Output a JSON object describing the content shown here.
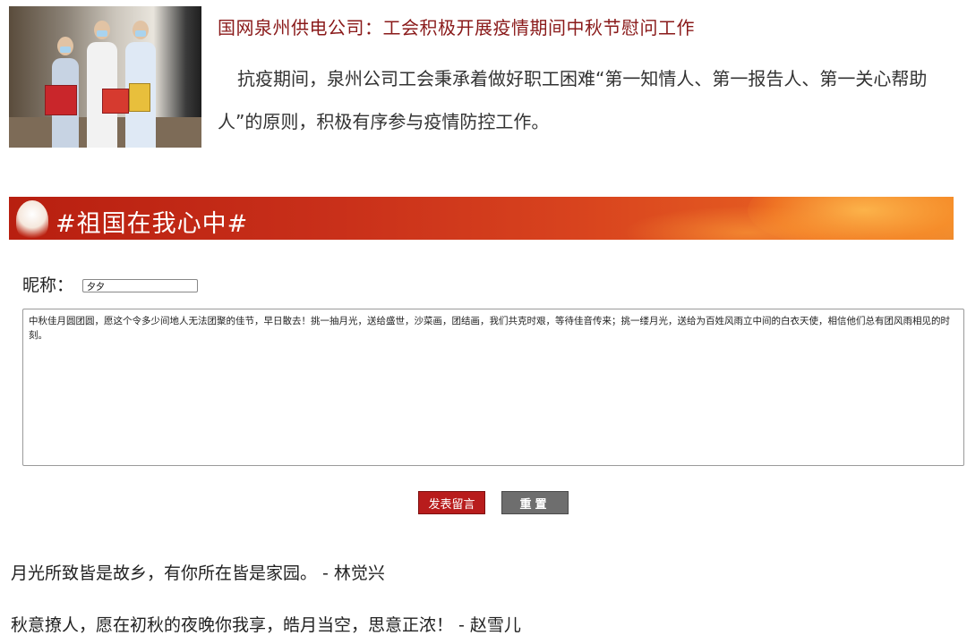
{
  "article": {
    "title": "国网泉州供电公司：工会积极开展疫情期间中秋节慰问工作",
    "body": "抗疫期间，泉州公司工会秉承着做好职工困难“第一知情人、第一报告人、第一关心帮助人”的原则，积极有序参与疫情防控工作。"
  },
  "banner": {
    "title": "#祖国在我心中#"
  },
  "form": {
    "nickname_label": "昵称：",
    "nickname_value": "夕夕",
    "message_value": "中秋佳月圆团圆，愿这个令多少间地人无法团聚的佳节，早日散去！挑一抽月光，送给盛世，沙菜画，团结画，我们共克时艰，等待佳音传来；挑一缕月光，送给为百姓风雨立中间的白衣天使，相信他们总有团风雨相见的时刻。",
    "submit_label": "发表留言",
    "reset_label": "重置"
  },
  "comments": [
    {
      "text": "月光所致皆是故乡，有你所在皆是家园。 - 林觉兴"
    },
    {
      "text": "秋意撩人，愿在初秋的夜晚你我享，皓月当空，思意正浓！ - 赵雪儿"
    }
  ],
  "colors": {
    "title_red": "#8a1a1a",
    "submit_red": "#b81c1c",
    "reset_gray": "#6e6e6e",
    "banner_start": "#b81f10",
    "banner_end": "#f08b2d"
  }
}
